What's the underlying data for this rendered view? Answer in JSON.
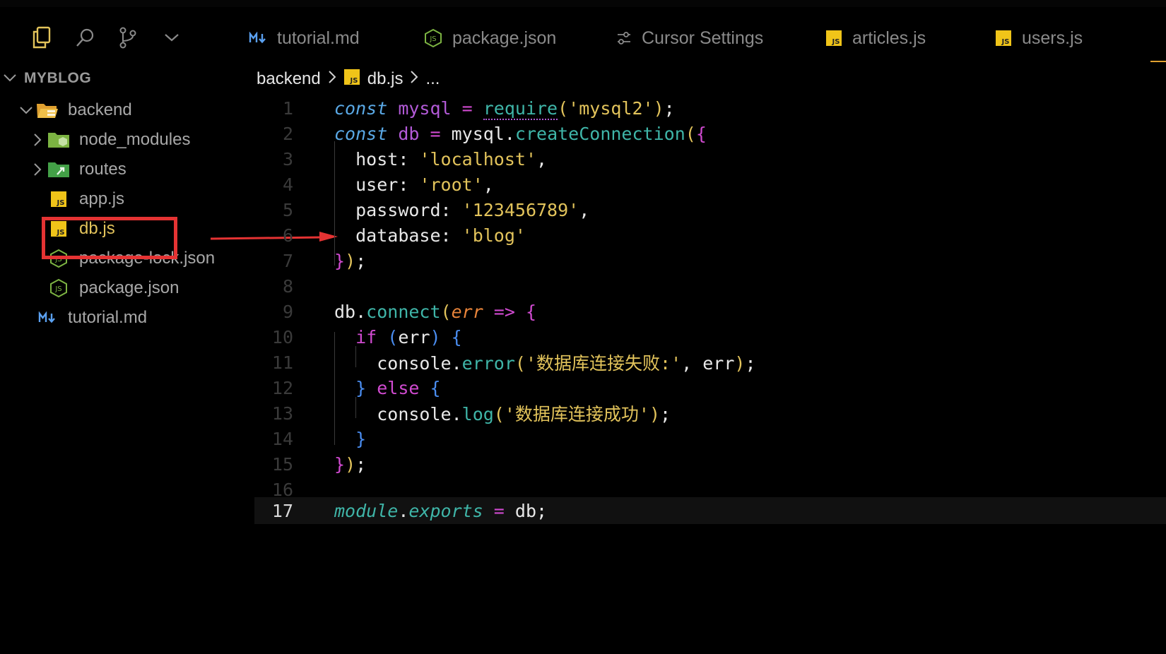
{
  "tabs": [
    {
      "label": "tutorial.md",
      "icon": "markdown-icon"
    },
    {
      "label": "package.json",
      "icon": "node-json-icon"
    },
    {
      "label": "Cursor Settings",
      "icon": "settings-sliders-icon"
    },
    {
      "label": "articles.js",
      "icon": "js-file-icon"
    },
    {
      "label": "users.js",
      "icon": "js-file-icon"
    }
  ],
  "explorer": {
    "title": "MYBLOG",
    "items": [
      {
        "label": "backend"
      },
      {
        "label": "node_modules"
      },
      {
        "label": "routes"
      },
      {
        "label": "app.js"
      },
      {
        "label": "db.js"
      },
      {
        "label": "package-lock.json"
      },
      {
        "label": "package.json"
      },
      {
        "label": "tutorial.md"
      }
    ]
  },
  "breadcrumb": {
    "folder": "backend",
    "file": "db.js",
    "more": "..."
  },
  "editor": {
    "line_numbers": [
      "1",
      "2",
      "3",
      "4",
      "5",
      "6",
      "7",
      "8",
      "9",
      "10",
      "11",
      "12",
      "13",
      "14",
      "15",
      "16",
      "17"
    ],
    "t": {
      "const": "const",
      "mysql": "mysql",
      "eq": " = ",
      "require": "require",
      "mysql2": "'mysql2'",
      "db": "db",
      "createConnection": "createConnection",
      "host": "host",
      "localhost": "'localhost'",
      "user": "user",
      "root": "'root'",
      "password": "password",
      "pwd": "'123456789'",
      "database": "database",
      "blog": "'blog'",
      "connect": "connect",
      "err": "err",
      "arrow": " => ",
      "if": "if",
      "console": "console",
      "error": "error",
      "fail_msg": "'数据库连接失败:'",
      "else": "else",
      "log": "log",
      "ok_msg": "'数据库连接成功'",
      "module": "module",
      "exports": "exports"
    }
  },
  "colors": {
    "highlight_box": "#e53333",
    "arrow": "#e53333",
    "js_icon": "#f0c419",
    "node_icon": "#7cb342"
  }
}
